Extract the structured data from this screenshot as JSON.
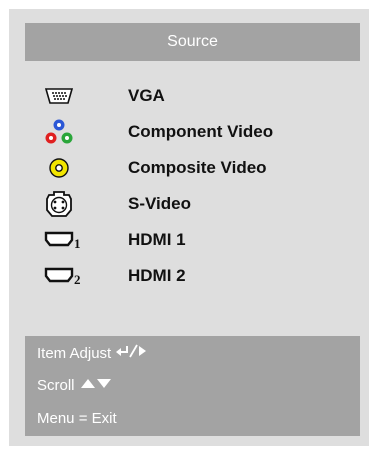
{
  "menu": {
    "title": "Source",
    "items": [
      {
        "label": "VGA",
        "icon": "vga-icon"
      },
      {
        "label": "Component Video",
        "icon": "component-video-icon"
      },
      {
        "label": "Composite Video",
        "icon": "composite-video-icon"
      },
      {
        "label": "S-Video",
        "icon": "s-video-icon"
      },
      {
        "label": "HDMI 1",
        "icon": "hdmi1-icon"
      },
      {
        "label": "HDMI 2",
        "icon": "hdmi2-icon"
      }
    ]
  },
  "help": {
    "item_adjust": "Item Adjust",
    "scroll": "Scroll",
    "menu_exit": "Menu = Exit"
  },
  "colors": {
    "panel": "#dedede",
    "bar": "#a3a3a3",
    "text": "#111111",
    "component_blue": "#2b57d6",
    "component_red": "#e02020",
    "component_green": "#2aa63a",
    "composite_yellow": "#f2e500"
  }
}
